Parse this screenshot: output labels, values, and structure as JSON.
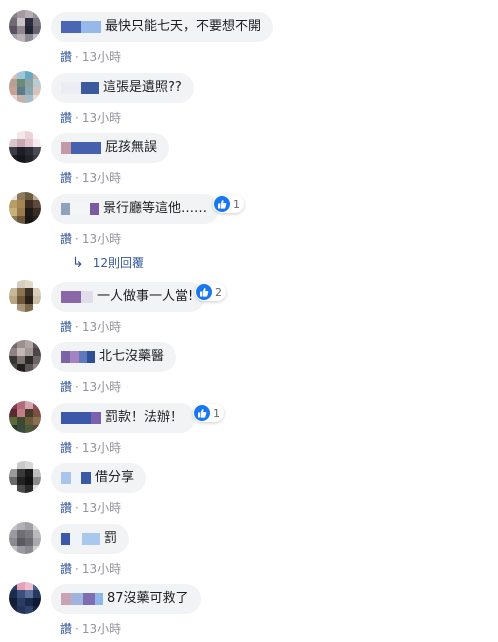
{
  "ui": {
    "like_label": "讚",
    "separator": "·"
  },
  "comments": [
    {
      "text": "最快只能七天，不要想不開",
      "time": "13小時"
    },
    {
      "text": "這張是遺照??",
      "time": "13小時"
    },
    {
      "text": "屁孩無誤",
      "time": "13小時"
    },
    {
      "text": "景行廳等這他……",
      "time": "13小時",
      "reaction_count": "1"
    },
    {
      "text": "一人做事一人當!",
      "time": "13小時",
      "reaction_count": "2"
    },
    {
      "text": "北七沒藥醫",
      "time": "13小時"
    },
    {
      "text": "罰款！法辦！",
      "time": "13小時",
      "reaction_count": "1"
    },
    {
      "text": "借分享",
      "time": "13小時"
    },
    {
      "text": "罰",
      "time": "13小時"
    },
    {
      "text": "87沒藥可救了",
      "time": "13小時"
    }
  ],
  "replies": {
    "label": "12則回覆",
    "arrow_icon": "reply-arrow-icon"
  },
  "colors": {
    "link": "#365899",
    "bubble": "#f2f3f5",
    "like_blue": "#1877f2"
  }
}
